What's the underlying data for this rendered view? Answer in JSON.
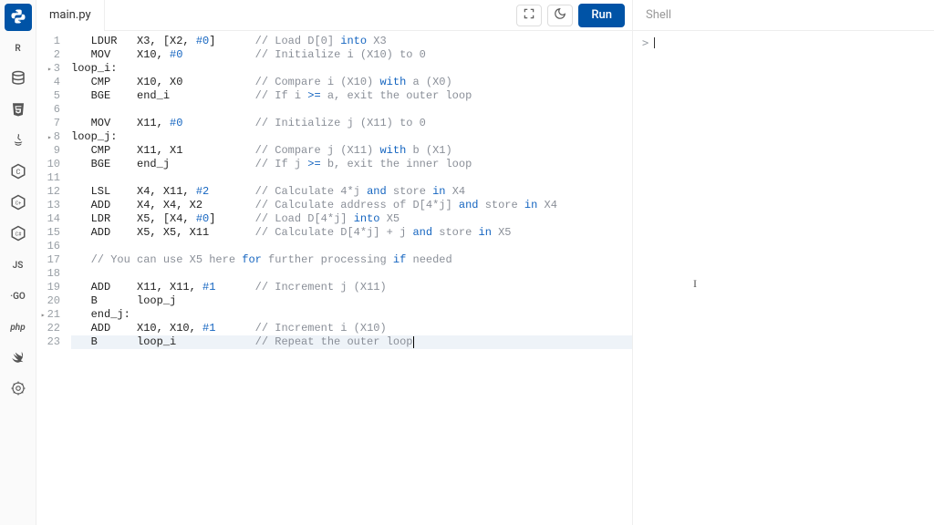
{
  "sidebar": {
    "items": [
      {
        "id": "python",
        "label": "Py",
        "active": true
      },
      {
        "id": "r",
        "label": "R",
        "active": false
      },
      {
        "id": "db",
        "label": "DB",
        "active": false
      },
      {
        "id": "html",
        "label": "H5",
        "active": false
      },
      {
        "id": "java",
        "label": "J",
        "active": false
      },
      {
        "id": "c",
        "label": "C",
        "active": false
      },
      {
        "id": "cpp",
        "label": "C+",
        "active": false
      },
      {
        "id": "csharp",
        "label": "C#",
        "active": false
      },
      {
        "id": "js",
        "label": "JS",
        "active": false
      },
      {
        "id": "go",
        "label": "·GO",
        "active": false
      },
      {
        "id": "php",
        "label": "php",
        "active": false
      },
      {
        "id": "swift",
        "label": "Sw",
        "active": false
      },
      {
        "id": "rust",
        "label": "Rs",
        "active": false
      }
    ]
  },
  "tabs": {
    "active": "main.py"
  },
  "toolbar": {
    "run_label": "Run"
  },
  "shell": {
    "title": "Shell",
    "prompt": ">"
  },
  "colors": {
    "accent": "#0053a6"
  },
  "code": {
    "lines": [
      {
        "n": 1,
        "fold": false,
        "raw": "   LDUR   X3, [X2, #0]      // Load D[0] into X3"
      },
      {
        "n": 2,
        "fold": false,
        "raw": "   MOV    X10, #0           // Initialize i (X10) to 0"
      },
      {
        "n": 3,
        "fold": true,
        "raw": "loop_i:"
      },
      {
        "n": 4,
        "fold": false,
        "raw": "   CMP    X10, X0           // Compare i (X10) with a (X0)"
      },
      {
        "n": 5,
        "fold": false,
        "raw": "   BGE    end_i             // If i >= a, exit the outer loop"
      },
      {
        "n": 6,
        "fold": false,
        "raw": ""
      },
      {
        "n": 7,
        "fold": false,
        "raw": "   MOV    X11, #0           // Initialize j (X11) to 0"
      },
      {
        "n": 8,
        "fold": true,
        "raw": "loop_j:"
      },
      {
        "n": 9,
        "fold": false,
        "raw": "   CMP    X11, X1           // Compare j (X11) with b (X1)"
      },
      {
        "n": 10,
        "fold": false,
        "raw": "   BGE    end_j             // If j >= b, exit the inner loop"
      },
      {
        "n": 11,
        "fold": false,
        "raw": ""
      },
      {
        "n": 12,
        "fold": false,
        "raw": "   LSL    X4, X11, #2       // Calculate 4*j and store in X4"
      },
      {
        "n": 13,
        "fold": false,
        "raw": "   ADD    X4, X4, X2        // Calculate address of D[4*j] and store in X4"
      },
      {
        "n": 14,
        "fold": false,
        "raw": "   LDR    X5, [X4, #0]      // Load D[4*j] into X5"
      },
      {
        "n": 15,
        "fold": false,
        "raw": "   ADD    X5, X5, X11       // Calculate D[4*j] + j and store in X5"
      },
      {
        "n": 16,
        "fold": false,
        "raw": ""
      },
      {
        "n": 17,
        "fold": false,
        "raw": "   // You can use X5 here for further processing if needed"
      },
      {
        "n": 18,
        "fold": false,
        "raw": ""
      },
      {
        "n": 19,
        "fold": false,
        "raw": "   ADD    X11, X11, #1      // Increment j (X11)"
      },
      {
        "n": 20,
        "fold": false,
        "raw": "   B      loop_j"
      },
      {
        "n": 21,
        "fold": true,
        "raw": "   end_j:"
      },
      {
        "n": 22,
        "fold": false,
        "raw": "   ADD    X10, X10, #1      // Increment i (X10)"
      },
      {
        "n": 23,
        "fold": false,
        "raw": "   B      loop_i            // Repeat the outer loop"
      }
    ],
    "current_line": 23
  }
}
